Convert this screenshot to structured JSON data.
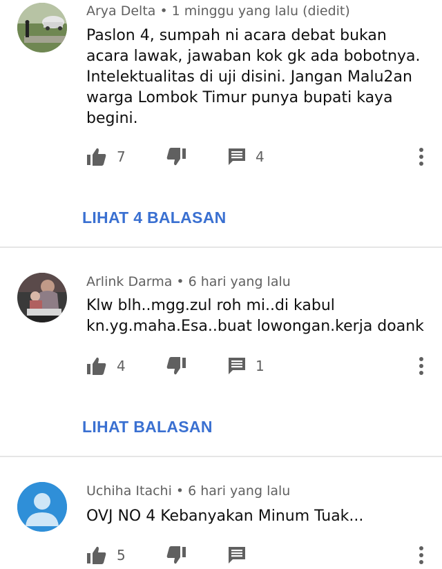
{
  "comments": [
    {
      "author": "Arya Delta",
      "time": "1 minggu yang lalu (diedit)",
      "lines": [
        "Paslon 4, sumpah ni acara debat bukan",
        "acara lawak, jawaban kok gk ada bobotnya.",
        "Intelektualitas di uji disini. Jangan Malu2an",
        "warga Lombok Timur punya bupati kaya",
        "begini."
      ],
      "likes": "7",
      "replies_count": "4",
      "view_replies": "LIHAT 4 BALASAN"
    },
    {
      "author": "Arlink Darma",
      "time": "6 hari yang lalu",
      "lines": [
        "Klw blh..mgg.zul roh mi..di kabul",
        "kn.yg.maha.Esa..buat lowongan.kerja doank"
      ],
      "likes": "4",
      "replies_count": "1",
      "view_replies": "LIHAT BALASAN"
    },
    {
      "author": "Uchiha Itachi",
      "time": "6 hari yang lalu",
      "lines": [
        "OVJ NO 4 Kebanyakan Minum Tuak..."
      ],
      "likes": "5",
      "replies_count": ""
    }
  ],
  "separator": "•",
  "icons": {
    "like": "thumb-up-icon",
    "dislike": "thumb-down-icon",
    "reply": "comment-icon",
    "menu": "more-vert-icon",
    "default_avatar": "person-icon"
  },
  "colors": {
    "link": "#3a70d1",
    "icon": "#606060",
    "default_avatar_bg": "#2f8fd8"
  }
}
